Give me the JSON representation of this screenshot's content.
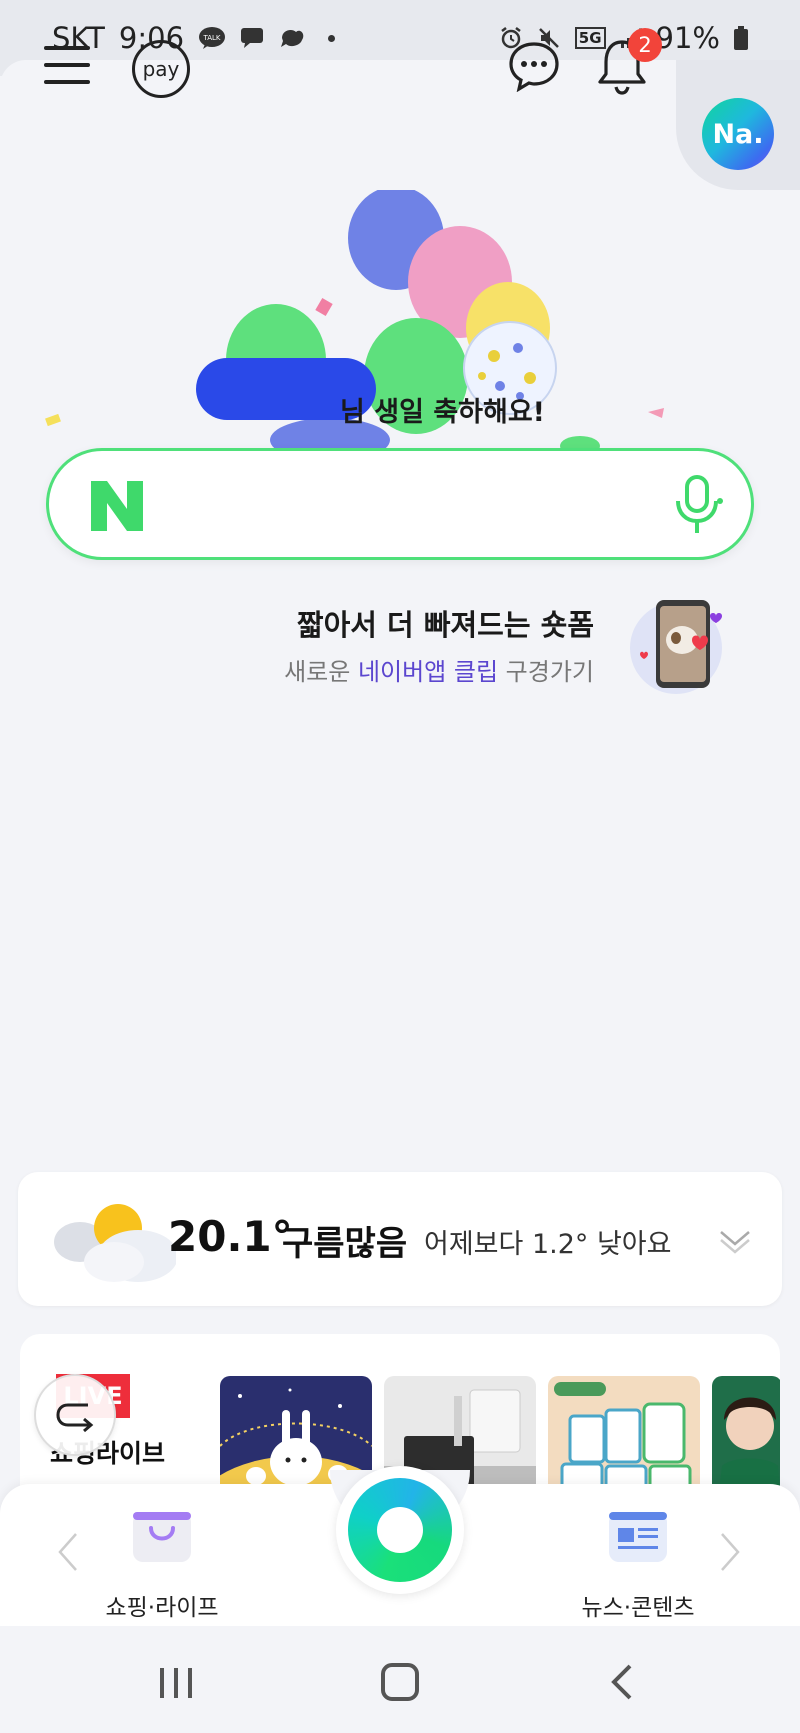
{
  "status_bar": {
    "carrier": "SKT",
    "time": "9:06",
    "network": "5G",
    "battery": "91%"
  },
  "header": {
    "pay_label": "pay",
    "notification_count": "2",
    "profile_label": "Na."
  },
  "hero": {
    "birthday_message": "님 생일 축하해요!"
  },
  "search": {
    "placeholder": ""
  },
  "promo": {
    "title": "짧아서 더 빠져드는 숏폼",
    "subtitle_pre": "새로운 ",
    "subtitle_highlight": "네이버앱 클립",
    "subtitle_post": " 구경가기"
  },
  "weather": {
    "temperature": "20.1°",
    "condition": "구름많음",
    "comparison": "어제보다 1.2° 낮아요"
  },
  "shopping": {
    "badge": "LIVE",
    "title": "쇼핑라이브"
  },
  "dock": {
    "left_label": "쇼핑·라이프",
    "right_label": "뉴스·콘텐츠"
  },
  "colors": {
    "naver_green": "#03c75a",
    "search_border": "#4fe07a",
    "badge_red": "#f2443a",
    "highlight_purple": "#5b46cf"
  }
}
